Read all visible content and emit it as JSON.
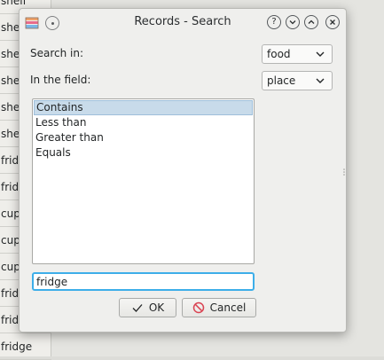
{
  "background_list": {
    "cells": [
      "shelf",
      "shelf",
      "shelf",
      "shelf",
      "shelf",
      "shelf",
      "fridge",
      "fridge",
      "cupboard",
      "cupboard",
      "cupboard",
      "fridge",
      "fridge",
      "fridge"
    ]
  },
  "window": {
    "title": "Records - Search",
    "buttons": {
      "help": "?",
      "minimize": "⌄",
      "maximize": "⌃",
      "close": "✕"
    }
  },
  "form": {
    "search_in_label": "Search in:",
    "search_in_value": "food",
    "field_label": "In the field:",
    "field_value": "place"
  },
  "match_options": [
    "Contains",
    "Less than",
    "Greater than",
    "Equals"
  ],
  "selected_option": "Contains",
  "search_text": "fridge",
  "ok_label": "OK",
  "cancel_label": "Cancel",
  "colors": {
    "accent": "#3daee9",
    "selection": "#c8dbea",
    "cancel_icon": "#da4453"
  }
}
